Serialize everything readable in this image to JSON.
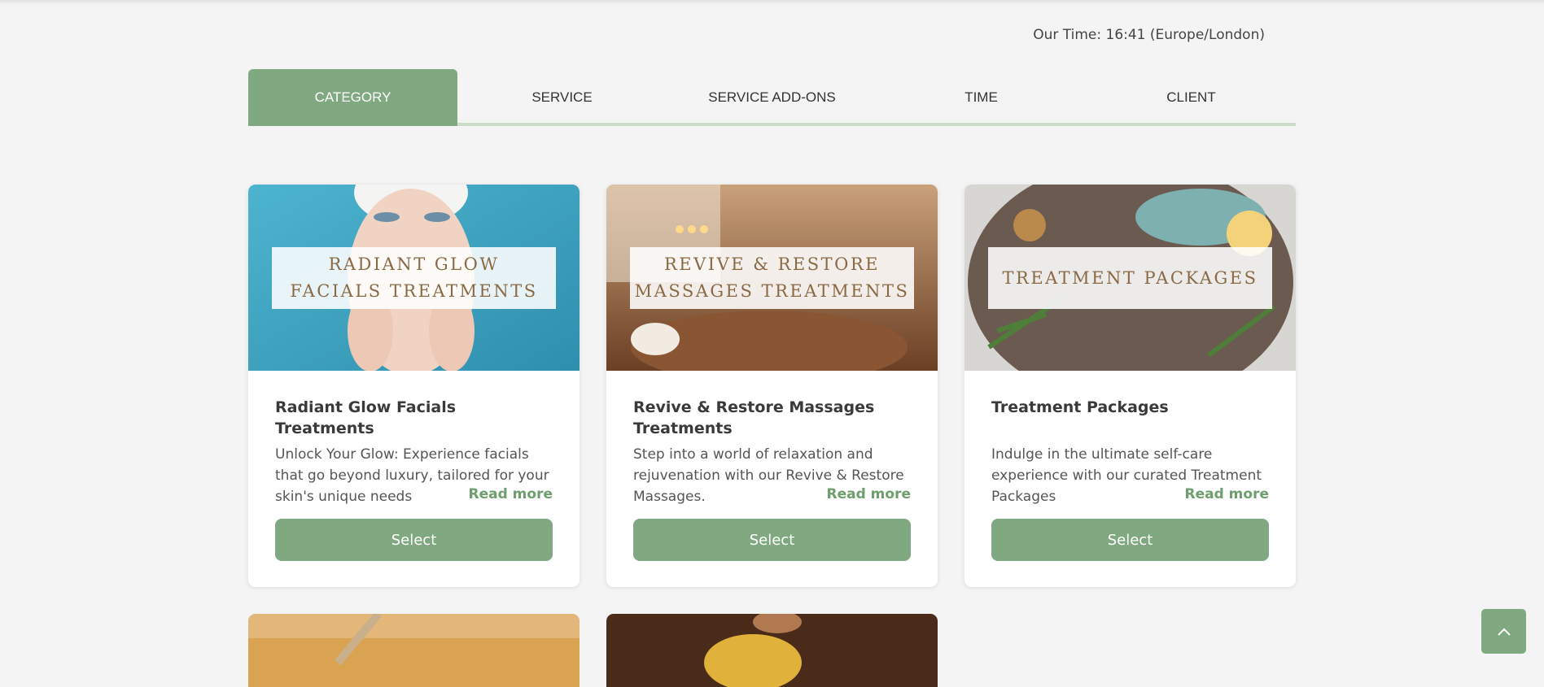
{
  "header": {
    "time_text": "Our Time: 16:41 (Europe/London)"
  },
  "steps": [
    {
      "label": "CATEGORY",
      "active": true
    },
    {
      "label": "SERVICE",
      "active": false
    },
    {
      "label": "SERVICE ADD-ONS",
      "active": false
    },
    {
      "label": "TIME",
      "active": false
    },
    {
      "label": "CLIENT",
      "active": false
    }
  ],
  "cards": [
    {
      "overlay": "RADIANT GLOW\nFACIALS TREATMENTS",
      "title": "Radiant Glow Facials Treatments",
      "description": "Unlock Your Glow: Experience facials that go beyond luxury, tailored for your skin's unique needs",
      "read_more": "Read more",
      "button": "Select"
    },
    {
      "overlay": "REVIVE & RESTORE\nMASSAGES TREATMENTS",
      "title": "Revive & Restore Massages Treatments",
      "description": "Step into a world of relaxation and rejuvenation with our Revive & Restore Massages.",
      "read_more": "Read more",
      "button": "Select"
    },
    {
      "overlay": "TREATMENT PACKAGES",
      "title": "Treatment Packages",
      "description": "Indulge in the ultimate self-care experience with our curated Treatment Packages",
      "read_more": "Read more",
      "button": "Select"
    }
  ],
  "colors": {
    "accent": "#81a981",
    "accent_text": "#6e9e6e",
    "overlay_text": "#8a6a45",
    "background": "#f4f4f4"
  },
  "icons": {
    "scroll_top": "chevron-up-icon"
  }
}
